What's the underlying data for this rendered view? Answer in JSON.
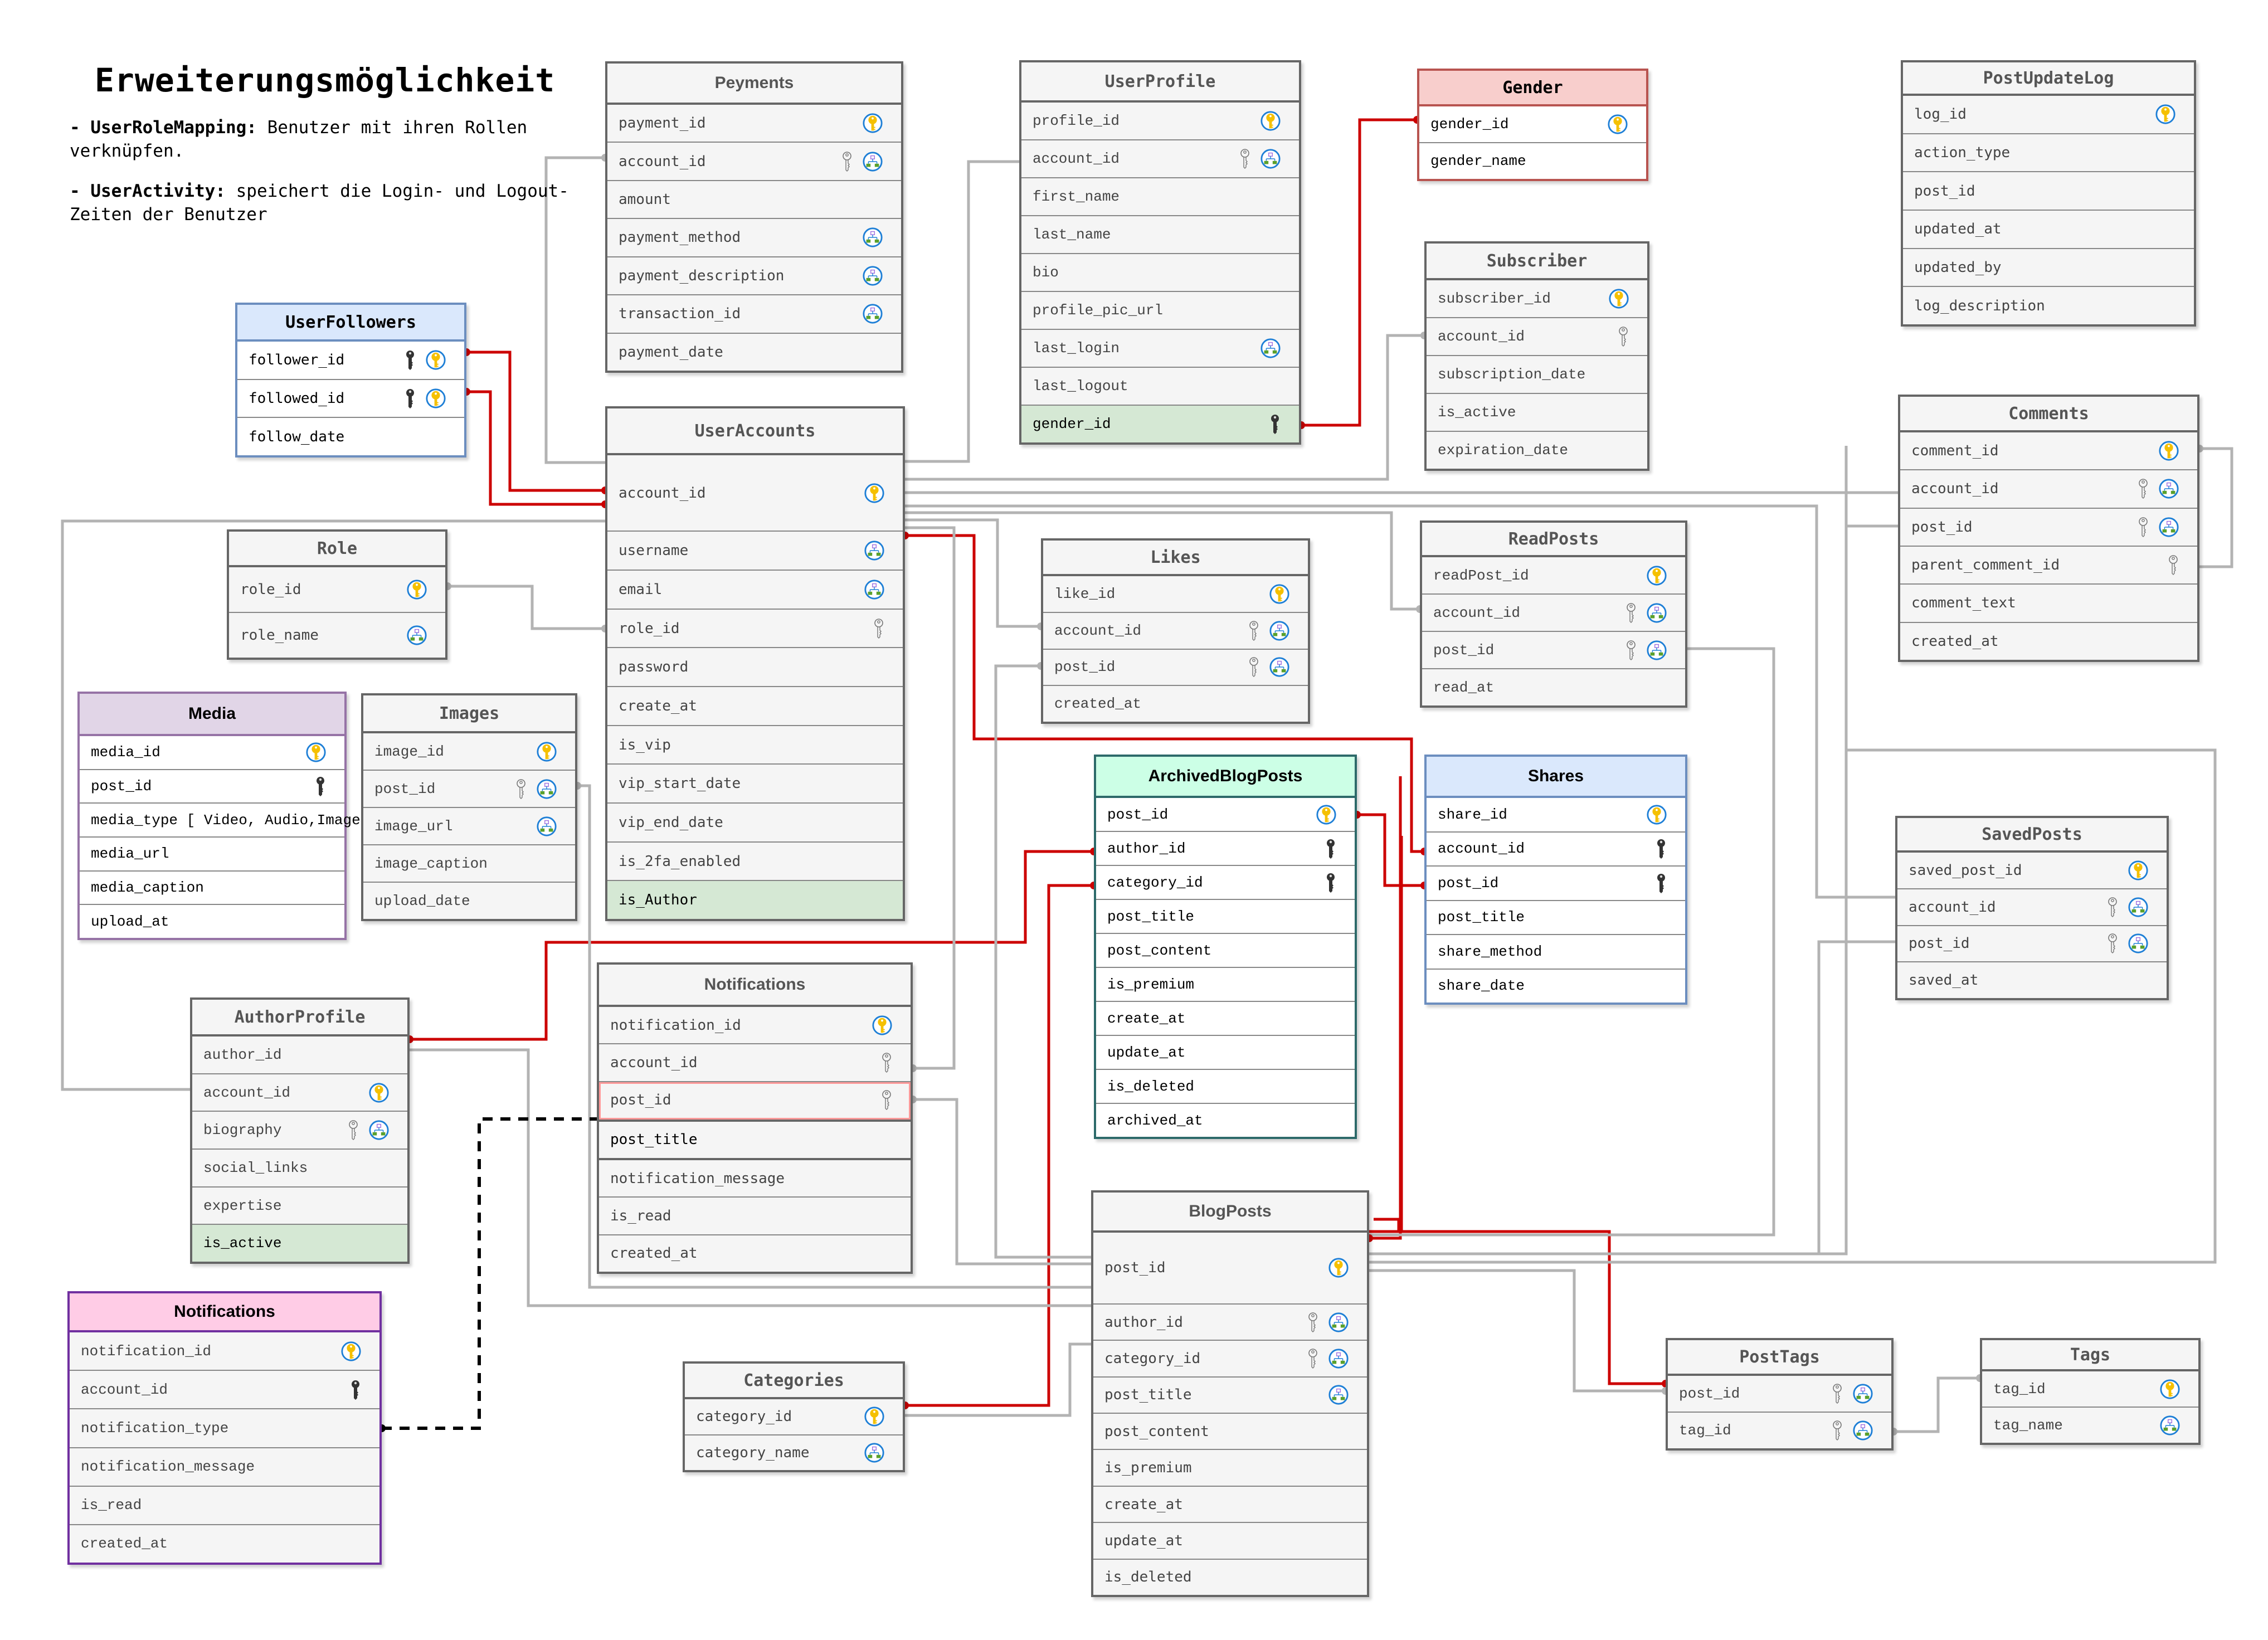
{
  "note": {
    "title": "Erweiterungsmöglichkeit",
    "items": [
      {
        "term": "- UserRoleMapping:",
        "text": " Benutzer mit ihren Rollen verknüpfen."
      },
      {
        "term": "- UserActivity:",
        "text": " speichert die Login- und Logout-Zeiten der Benutzer"
      }
    ]
  },
  "legend_icons": {
    "pk": "primary-key-icon",
    "fk": "foreign-key-outline-icon",
    "fk_dark": "foreign-key-filled-icon",
    "idx": "index-hierarchy-icon"
  },
  "colors": {
    "relation_primary": "#cc0000",
    "relation_default": "#b3b3b3",
    "relation_dashed": "#000000",
    "header_gender": "#f8cecc",
    "header_userfollowers": "#dae8fc",
    "header_media": "#e1d5e7",
    "header_archived": "#ccffe6",
    "header_shares": "#dae8fc",
    "header_notifications_pink": "#ffcce6",
    "row_highlight": "#d5e8d4"
  },
  "tables": {
    "peyments": {
      "name": "Peyments",
      "fields": [
        {
          "name": "payment_id",
          "icons": [
            "pk"
          ]
        },
        {
          "name": "account_id",
          "icons": [
            "fk",
            "idx"
          ]
        },
        {
          "name": "amount",
          "icons": []
        },
        {
          "name": "payment_method",
          "icons": [
            "idx"
          ]
        },
        {
          "name": "payment_description",
          "icons": [
            "idx"
          ]
        },
        {
          "name": "transaction_id",
          "icons": [
            "idx"
          ]
        },
        {
          "name": "payment_date",
          "icons": []
        }
      ]
    },
    "userprofile": {
      "name": "UserProfile",
      "fields": [
        {
          "name": "profile_id",
          "icons": [
            "pk"
          ]
        },
        {
          "name": "account_id",
          "icons": [
            "fk",
            "idx"
          ]
        },
        {
          "name": "first_name",
          "icons": []
        },
        {
          "name": "last_name",
          "icons": []
        },
        {
          "name": "bio",
          "icons": []
        },
        {
          "name": "profile_pic_url",
          "icons": []
        },
        {
          "name": "last_login",
          "icons": [
            "idx"
          ]
        },
        {
          "name": "last_logout",
          "icons": []
        },
        {
          "name": "gender_id",
          "icons": [
            "fk_dark"
          ],
          "highlight": true
        }
      ]
    },
    "gender": {
      "name": "Gender",
      "fields": [
        {
          "name": "gender_id",
          "icons": [
            "pk"
          ]
        },
        {
          "name": "gender_name",
          "icons": []
        }
      ]
    },
    "postupdatelog": {
      "name": "PostUpdateLog",
      "fields": [
        {
          "name": "log_id",
          "icons": [
            "pk"
          ]
        },
        {
          "name": "action_type",
          "icons": []
        },
        {
          "name": "post_id",
          "icons": []
        },
        {
          "name": "updated_at",
          "icons": []
        },
        {
          "name": "updated_by",
          "icons": []
        },
        {
          "name": "log_description",
          "icons": []
        }
      ]
    },
    "userfollowers": {
      "name": "UserFollowers",
      "fields": [
        {
          "name": "follower_id",
          "icons": [
            "fk_dark",
            "pk"
          ]
        },
        {
          "name": "followed_id",
          "icons": [
            "fk_dark",
            "pk"
          ]
        },
        {
          "name": "follow_date",
          "icons": []
        }
      ]
    },
    "subscriber": {
      "name": "Subscriber",
      "fields": [
        {
          "name": "subscriber_id",
          "icons": [
            "pk"
          ]
        },
        {
          "name": "account_id",
          "icons": [
            "fk"
          ]
        },
        {
          "name": "subscription_date",
          "icons": []
        },
        {
          "name": "is_active",
          "icons": []
        },
        {
          "name": "expiration_date",
          "icons": []
        }
      ]
    },
    "comments": {
      "name": "Comments",
      "fields": [
        {
          "name": "comment_id",
          "icons": [
            "pk"
          ]
        },
        {
          "name": "account_id",
          "icons": [
            "fk",
            "idx"
          ]
        },
        {
          "name": "post_id",
          "icons": [
            "fk",
            "idx"
          ]
        },
        {
          "name": "parent_comment_id",
          "icons": [
            "fk"
          ]
        },
        {
          "name": "comment_text",
          "icons": []
        },
        {
          "name": "created_at",
          "icons": []
        }
      ]
    },
    "useraccounts": {
      "name": "UserAccounts",
      "fields": [
        {
          "name": "account_id",
          "icons": [
            "pk"
          ],
          "tall": true
        },
        {
          "name": "username",
          "icons": [
            "idx"
          ]
        },
        {
          "name": "email",
          "icons": [
            "idx"
          ]
        },
        {
          "name": "role_id",
          "icons": [
            "fk"
          ]
        },
        {
          "name": "password",
          "icons": []
        },
        {
          "name": "create_at",
          "icons": []
        },
        {
          "name": "is_vip",
          "icons": []
        },
        {
          "name": "vip_start_date",
          "icons": []
        },
        {
          "name": "vip_end_date",
          "icons": []
        },
        {
          "name": "is_2fa_enabled",
          "icons": []
        },
        {
          "name": "is_Author",
          "icons": [],
          "highlight": true
        }
      ]
    },
    "role": {
      "name": "Role",
      "fields": [
        {
          "name": "role_id",
          "icons": [
            "pk"
          ]
        },
        {
          "name": "role_name",
          "icons": [
            "idx"
          ]
        }
      ]
    },
    "likes": {
      "name": "Likes",
      "fields": [
        {
          "name": "like_id",
          "icons": [
            "pk"
          ]
        },
        {
          "name": "account_id",
          "icons": [
            "fk",
            "idx"
          ]
        },
        {
          "name": "post_id",
          "icons": [
            "fk",
            "idx"
          ]
        },
        {
          "name": "created_at",
          "icons": []
        }
      ]
    },
    "readposts": {
      "name": "ReadPosts",
      "fields": [
        {
          "name": "readPost_id",
          "icons": [
            "pk"
          ]
        },
        {
          "name": "account_id",
          "icons": [
            "fk",
            "idx"
          ]
        },
        {
          "name": "post_id",
          "icons": [
            "fk",
            "idx"
          ]
        },
        {
          "name": "read_at",
          "icons": []
        }
      ]
    },
    "media": {
      "name": "Media",
      "fields": [
        {
          "name": "media_id",
          "icons": [
            "pk"
          ]
        },
        {
          "name": "post_id",
          "icons": [
            "fk_dark"
          ]
        },
        {
          "name": "media_type [ Video, Audio,Image]",
          "icons": []
        },
        {
          "name": "media_url",
          "icons": []
        },
        {
          "name": "media_caption",
          "icons": []
        },
        {
          "name": "upload_at",
          "icons": []
        }
      ]
    },
    "images": {
      "name": "Images",
      "fields": [
        {
          "name": "image_id",
          "icons": [
            "pk"
          ]
        },
        {
          "name": "post_id",
          "icons": [
            "fk",
            "idx"
          ]
        },
        {
          "name": "image_url",
          "icons": [
            "idx"
          ]
        },
        {
          "name": "image_caption",
          "icons": []
        },
        {
          "name": "upload_date",
          "icons": []
        }
      ]
    },
    "archivedblogposts": {
      "name": "ArchivedBlogPosts",
      "fields": [
        {
          "name": "post_id",
          "icons": [
            "pk"
          ]
        },
        {
          "name": "author_id",
          "icons": [
            "fk_dark"
          ]
        },
        {
          "name": "category_id",
          "icons": [
            "fk_dark"
          ]
        },
        {
          "name": "post_title",
          "icons": []
        },
        {
          "name": "post_content",
          "icons": []
        },
        {
          "name": "is_premium",
          "icons": []
        },
        {
          "name": "create_at",
          "icons": []
        },
        {
          "name": "update_at",
          "icons": []
        },
        {
          "name": "is_deleted",
          "icons": []
        },
        {
          "name": "archived_at",
          "icons": []
        }
      ]
    },
    "shares": {
      "name": "Shares",
      "fields": [
        {
          "name": "share_id",
          "icons": [
            "pk"
          ]
        },
        {
          "name": "account_id",
          "icons": [
            "fk_dark"
          ]
        },
        {
          "name": "post_id",
          "icons": [
            "fk_dark"
          ]
        },
        {
          "name": "post_title",
          "icons": []
        },
        {
          "name": "share_method",
          "icons": []
        },
        {
          "name": "share_date",
          "icons": []
        }
      ]
    },
    "savedposts": {
      "name": "SavedPosts",
      "fields": [
        {
          "name": "saved_post_id",
          "icons": [
            "pk"
          ]
        },
        {
          "name": "account_id",
          "icons": [
            "fk",
            "idx"
          ]
        },
        {
          "name": "post_id",
          "icons": [
            "fk",
            "idx"
          ]
        },
        {
          "name": "saved_at",
          "icons": []
        }
      ]
    },
    "authorprofile": {
      "name": "AuthorProfile",
      "fields": [
        {
          "name": "author_id",
          "icons": []
        },
        {
          "name": "account_id",
          "icons": [
            "pk"
          ]
        },
        {
          "name": "biography",
          "icons": [
            "fk",
            "idx"
          ]
        },
        {
          "name": "social_links",
          "icons": []
        },
        {
          "name": "expertise",
          "icons": []
        },
        {
          "name": "is_active",
          "icons": [],
          "highlight": true
        }
      ]
    },
    "notifications_mid": {
      "name": "Notifications",
      "fields": [
        {
          "name": "notification_id",
          "icons": [
            "pk"
          ]
        },
        {
          "name": "account_id",
          "icons": [
            "fk"
          ]
        },
        {
          "name": "post_id",
          "icons": [
            "fk"
          ],
          "redborder": true
        },
        {
          "name": "post_title",
          "icons": [],
          "dark": true
        },
        {
          "name": "notification_message",
          "icons": []
        },
        {
          "name": "is_read",
          "icons": []
        },
        {
          "name": "created_at",
          "icons": []
        }
      ]
    },
    "notifications_pink": {
      "name": "Notifications",
      "fields": [
        {
          "name": "notification_id",
          "icons": [
            "pk"
          ]
        },
        {
          "name": "account_id",
          "icons": [
            "fk_dark"
          ]
        },
        {
          "name": "notification_type",
          "icons": []
        },
        {
          "name": "notification_message",
          "icons": []
        },
        {
          "name": "is_read",
          "icons": []
        },
        {
          "name": "created_at",
          "icons": []
        }
      ]
    },
    "categories": {
      "name": "Categories",
      "fields": [
        {
          "name": "category_id",
          "icons": [
            "pk"
          ]
        },
        {
          "name": "category_name",
          "icons": [
            "idx"
          ]
        }
      ]
    },
    "blogposts": {
      "name": "BlogPosts",
      "fields": [
        {
          "name": "post_id",
          "icons": [
            "pk"
          ],
          "tall": true
        },
        {
          "name": "author_id",
          "icons": [
            "fk",
            "idx"
          ]
        },
        {
          "name": "category_id",
          "icons": [
            "fk",
            "idx"
          ]
        },
        {
          "name": "post_title",
          "icons": [
            "idx"
          ]
        },
        {
          "name": "post_content",
          "icons": []
        },
        {
          "name": "is_premium",
          "icons": []
        },
        {
          "name": "create_at",
          "icons": []
        },
        {
          "name": "update_at",
          "icons": []
        },
        {
          "name": "is_deleted",
          "icons": []
        }
      ]
    },
    "posttags": {
      "name": "PostTags",
      "fields": [
        {
          "name": "post_id",
          "icons": [
            "fk",
            "idx"
          ]
        },
        {
          "name": "tag_id",
          "icons": [
            "fk",
            "idx"
          ]
        }
      ]
    },
    "tags": {
      "name": "Tags",
      "fields": [
        {
          "name": "tag_id",
          "icons": [
            "pk"
          ]
        },
        {
          "name": "tag_name",
          "icons": [
            "idx"
          ]
        }
      ]
    }
  }
}
